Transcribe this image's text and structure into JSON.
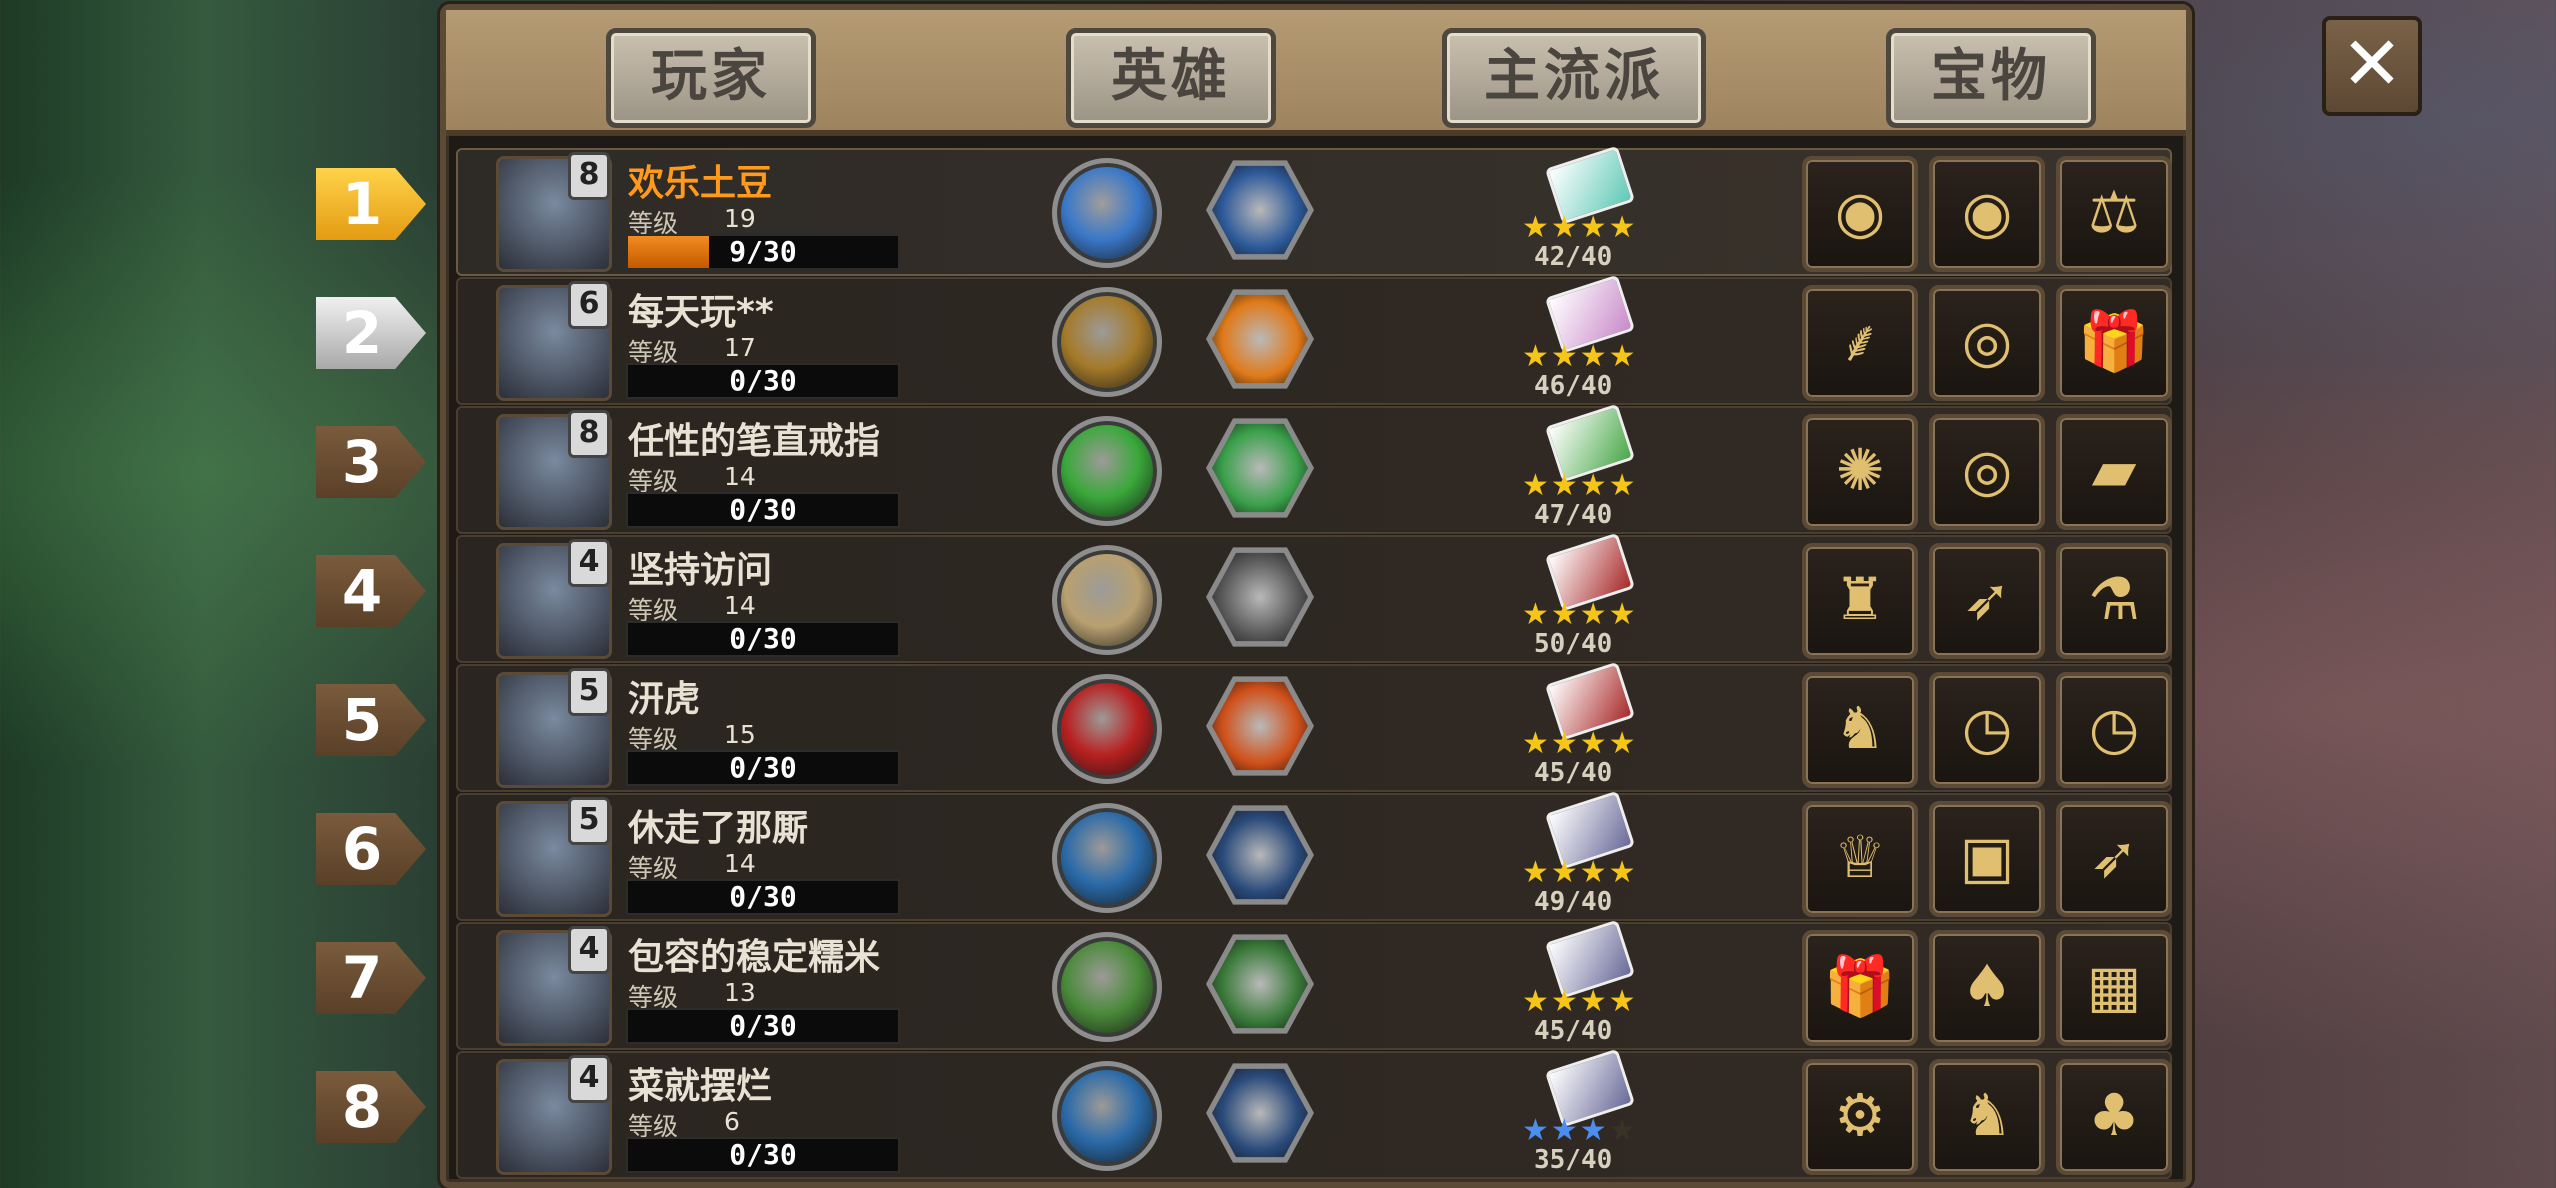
{
  "tabs": [
    {
      "label": "玩家"
    },
    {
      "label": "英雄"
    },
    {
      "label": "主流派"
    },
    {
      "label": "宝物"
    }
  ],
  "close_icon": "close-icon",
  "level_label": "等级",
  "players": [
    {
      "rank": "1",
      "rank_style": "gold",
      "name": "欢乐土豆",
      "name_style": "gold",
      "hero_level": "8",
      "level": "19",
      "progress_text": "9/30",
      "progress": 0.3,
      "score": "42/40",
      "stars": 4,
      "star_color": "gold",
      "skill_color": "#3a78c8",
      "hex_color": "#2e5a9a",
      "book_color": "#5fc9b6",
      "treasures": [
        "bottle-cap-icon",
        "bottle-cap-icon",
        "scales-icon"
      ]
    },
    {
      "rank": "2",
      "rank_style": "silver",
      "name": "每天玩**",
      "name_style": "normal",
      "hero_level": "6",
      "level": "17",
      "progress_text": "0/30",
      "progress": 0,
      "score": "46/40",
      "stars": 4,
      "star_color": "gold",
      "skill_color": "#a47a2a",
      "hex_color": "#e07a1a",
      "book_color": "#c98ac9",
      "treasures": [
        "broom-icon",
        "compass-icon",
        "gift-box-icon"
      ]
    },
    {
      "rank": "3",
      "rank_style": "bronze",
      "name": "任性的笔直戒指",
      "name_style": "normal",
      "hero_level": "8",
      "level": "14",
      "progress_text": "0/30",
      "progress": 0,
      "score": "47/40",
      "stars": 4,
      "star_color": "gold",
      "skill_color": "#3aa83a",
      "hex_color": "#3aa04a",
      "book_color": "#4aa84a",
      "treasures": [
        "rune-stone-icon",
        "compass-icon",
        "green-book-icon"
      ]
    },
    {
      "rank": "4",
      "rank_style": "bronze",
      "name": "坚持访问",
      "name_style": "normal",
      "hero_level": "4",
      "level": "14",
      "progress_text": "0/30",
      "progress": 0,
      "score": "50/40",
      "stars": 4,
      "star_color": "gold",
      "skill_color": "#b8a070",
      "hex_color": "#5a5a5a",
      "book_color": "#a82a2a",
      "treasures": [
        "lantern-icon",
        "dark-bow-icon",
        "potion-icon"
      ]
    },
    {
      "rank": "5",
      "rank_style": "bronze",
      "name": "汧虎",
      "name_style": "normal",
      "hero_level": "5",
      "level": "15",
      "progress_text": "0/30",
      "progress": 0,
      "score": "45/40",
      "stars": 4,
      "star_color": "gold",
      "skill_color": "#b82020",
      "hex_color": "#d0501a",
      "book_color": "#a82a2a",
      "treasures": [
        "red-ninja-icon",
        "pocket-watch-icon",
        "pocket-watch-icon"
      ]
    },
    {
      "rank": "6",
      "rank_style": "bronze",
      "name": "休走了那厮",
      "name_style": "normal",
      "hero_level": "5",
      "level": "14",
      "progress_text": "0/30",
      "progress": 0,
      "score": "49/40",
      "stars": 4,
      "star_color": "gold",
      "skill_color": "#2a6aa8",
      "hex_color": "#2a4a7a",
      "book_color": "#6a6a9a",
      "treasures": [
        "goblet-icon",
        "treasure-chest-icon",
        "dark-bow-icon"
      ]
    },
    {
      "rank": "7",
      "rank_style": "bronze",
      "name": "包容的稳定糯米",
      "name_style": "normal",
      "hero_level": "4",
      "level": "13",
      "progress_text": "0/30",
      "progress": 0,
      "score": "45/40",
      "stars": 4,
      "star_color": "gold",
      "skill_color": "#4a8a3a",
      "hex_color": "#3a7a3a",
      "book_color": "#6a6a9a",
      "treasures": [
        "gift-box-icon",
        "playing-cards-icon",
        "dark-chest-icon"
      ]
    },
    {
      "rank": "8",
      "rank_style": "bronze",
      "name": "菜就摆烂",
      "name_style": "normal",
      "hero_level": "4",
      "level": "6",
      "progress_text": "0/30",
      "progress": 0,
      "score": "35/40",
      "stars": 3,
      "star_color": "blue",
      "skill_color": "#2a6aa8",
      "hex_color": "#2a4a7a",
      "book_color": "#6a6a9a",
      "treasures": [
        "gear-icon",
        "red-ninja-icon",
        "clover-icon"
      ]
    }
  ]
}
